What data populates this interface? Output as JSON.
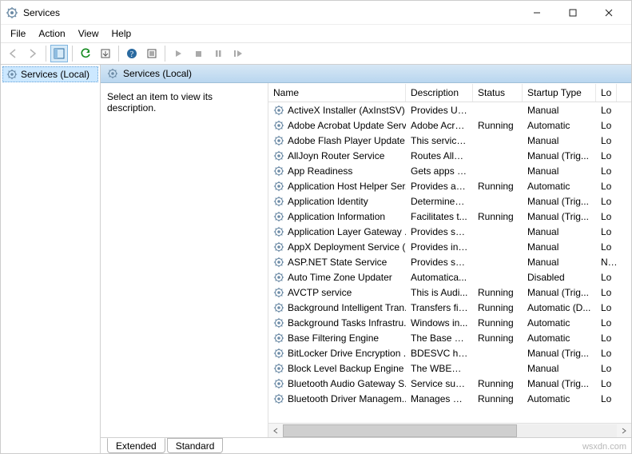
{
  "window": {
    "title": "Services"
  },
  "menubar": [
    "File",
    "Action",
    "View",
    "Help"
  ],
  "tree": {
    "root": "Services (Local)"
  },
  "caption": "Services (Local)",
  "desc_hint": "Select an item to view its description.",
  "columns": [
    "Name",
    "Description",
    "Status",
    "Startup Type",
    "Lo"
  ],
  "services": [
    {
      "name": "ActiveX Installer (AxInstSV)",
      "desc": "Provides Us...",
      "status": "",
      "startup": "Manual",
      "logon": "Lo"
    },
    {
      "name": "Adobe Acrobat Update Serv...",
      "desc": "Adobe Acro...",
      "status": "Running",
      "startup": "Automatic",
      "logon": "Lo"
    },
    {
      "name": "Adobe Flash Player Update ...",
      "desc": "This service ...",
      "status": "",
      "startup": "Manual",
      "logon": "Lo"
    },
    {
      "name": "AllJoyn Router Service",
      "desc": "Routes AllJo...",
      "status": "",
      "startup": "Manual (Trig...",
      "logon": "Lo"
    },
    {
      "name": "App Readiness",
      "desc": "Gets apps re...",
      "status": "",
      "startup": "Manual",
      "logon": "Lo"
    },
    {
      "name": "Application Host Helper Ser...",
      "desc": "Provides ad...",
      "status": "Running",
      "startup": "Automatic",
      "logon": "Lo"
    },
    {
      "name": "Application Identity",
      "desc": "Determines ...",
      "status": "",
      "startup": "Manual (Trig...",
      "logon": "Lo"
    },
    {
      "name": "Application Information",
      "desc": "Facilitates t...",
      "status": "Running",
      "startup": "Manual (Trig...",
      "logon": "Lo"
    },
    {
      "name": "Application Layer Gateway ...",
      "desc": "Provides su...",
      "status": "",
      "startup": "Manual",
      "logon": "Lo"
    },
    {
      "name": "AppX Deployment Service (...",
      "desc": "Provides inf...",
      "status": "",
      "startup": "Manual",
      "logon": "Lo"
    },
    {
      "name": "ASP.NET State Service",
      "desc": "Provides su...",
      "status": "",
      "startup": "Manual",
      "logon": "Ne"
    },
    {
      "name": "Auto Time Zone Updater",
      "desc": "Automatica...",
      "status": "",
      "startup": "Disabled",
      "logon": "Lo"
    },
    {
      "name": "AVCTP service",
      "desc": "This is Audi...",
      "status": "Running",
      "startup": "Manual (Trig...",
      "logon": "Lo"
    },
    {
      "name": "Background Intelligent Tran...",
      "desc": "Transfers fil...",
      "status": "Running",
      "startup": "Automatic (D...",
      "logon": "Lo"
    },
    {
      "name": "Background Tasks Infrastru...",
      "desc": "Windows in...",
      "status": "Running",
      "startup": "Automatic",
      "logon": "Lo"
    },
    {
      "name": "Base Filtering Engine",
      "desc": "The Base Fil...",
      "status": "Running",
      "startup": "Automatic",
      "logon": "Lo"
    },
    {
      "name": "BitLocker Drive Encryption ...",
      "desc": "BDESVC hos...",
      "status": "",
      "startup": "Manual (Trig...",
      "logon": "Lo"
    },
    {
      "name": "Block Level Backup Engine ...",
      "desc": "The WBENG...",
      "status": "",
      "startup": "Manual",
      "logon": "Lo"
    },
    {
      "name": "Bluetooth Audio Gateway S...",
      "desc": "Service sup...",
      "status": "Running",
      "startup": "Manual (Trig...",
      "logon": "Lo"
    },
    {
      "name": "Bluetooth Driver Managem...",
      "desc": "Manages BT...",
      "status": "Running",
      "startup": "Automatic",
      "logon": "Lo"
    }
  ],
  "tabs": {
    "extended": "Extended",
    "standard": "Standard"
  },
  "watermark": "wsxdn.com"
}
